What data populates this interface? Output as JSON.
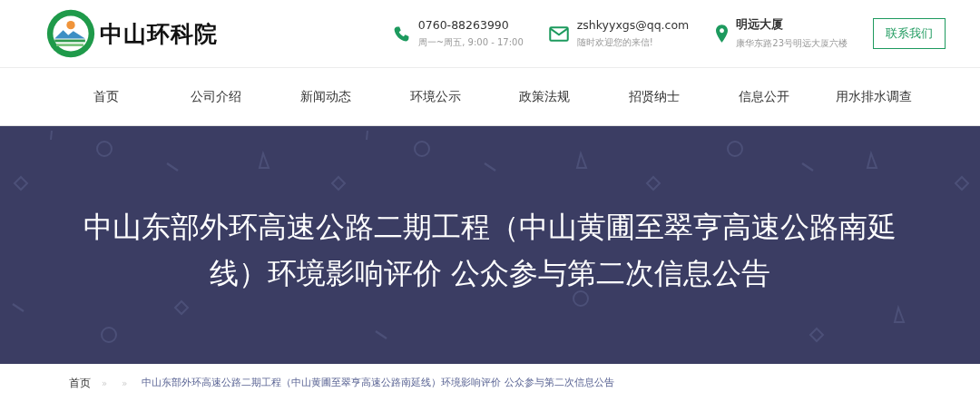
{
  "header": {
    "logo_text": "中山环科院",
    "contacts": [
      {
        "kind": "phone",
        "title": "0760-88263990",
        "subtitle": "周一~周五, 9:00 - 17:00"
      },
      {
        "kind": "email",
        "title": "zshkyyxgs@qq.com",
        "subtitle": "随时欢迎您的来信!"
      },
      {
        "kind": "location",
        "title": "明远大厦",
        "subtitle": "康华东路23号明远大厦六楼"
      }
    ],
    "contact_button": "联系我们"
  },
  "nav": [
    "首页",
    "公司介绍",
    "新闻动态",
    "环境公示",
    "政策法规",
    "招贤纳士",
    "信息公开",
    "用水排水调查"
  ],
  "banner": {
    "title": "中山东部外环高速公路二期工程（中山黄圃至翠亨高速公路南延线）环境影响评价 公众参与第二次信息公告"
  },
  "breadcrumb": [
    {
      "kind": "link",
      "text": "首页"
    },
    {
      "kind": "separator",
      "text": "»"
    },
    {
      "kind": "separator",
      "text": "»"
    },
    {
      "kind": "current",
      "text": "中山东部外环高速公路二期工程（中山黄圃至翠亨高速公路南延线）环境影响评价 公众参与第二次信息公告"
    }
  ]
}
